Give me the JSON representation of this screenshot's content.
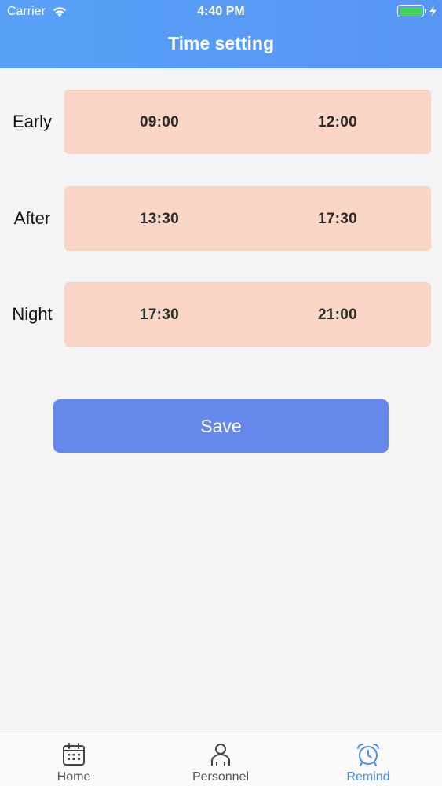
{
  "status_bar": {
    "carrier": "Carrier",
    "time": "4:40 PM",
    "battery_percent": 100,
    "battery_color": "#43d35a"
  },
  "header": {
    "title": "Time setting",
    "background_color": "#5a9cf5"
  },
  "shifts": [
    {
      "label": "Early",
      "start": "09:00",
      "end": "12:00"
    },
    {
      "label": "After",
      "start": "13:30",
      "end": "17:30"
    },
    {
      "label": "Night",
      "start": "17:30",
      "end": "21:00"
    }
  ],
  "shift_box_color": "#fbd6c7",
  "save_button": {
    "label": "Save",
    "color": "#6688ea"
  },
  "tab_bar": {
    "active_color": "#4a8fe6",
    "tabs": [
      {
        "label": "Home",
        "icon": "calendar-icon",
        "active": false
      },
      {
        "label": "Personnel",
        "icon": "person-icon",
        "active": false
      },
      {
        "label": "Remind",
        "icon": "alarm-clock-icon",
        "active": true
      }
    ]
  }
}
